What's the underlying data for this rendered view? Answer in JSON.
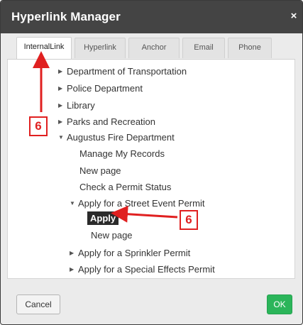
{
  "dialog": {
    "title": "Hyperlink Manager",
    "close_label": "×"
  },
  "tabs": [
    {
      "label": "InternalLink",
      "active": true
    },
    {
      "label": "Hyperlink",
      "active": false
    },
    {
      "label": "Anchor",
      "active": false
    },
    {
      "label": "Email",
      "active": false
    },
    {
      "label": "Phone",
      "active": false
    }
  ],
  "tree": [
    {
      "label": "Department of Transportation",
      "arrow": "right"
    },
    {
      "label": "Police Department",
      "arrow": "right"
    },
    {
      "label": "Library",
      "arrow": "right"
    },
    {
      "label": "Parks and Recreation",
      "arrow": "right"
    },
    {
      "label": "Augustus Fire Department",
      "arrow": "down"
    },
    {
      "label": "Manage My Records",
      "arrow": "none"
    },
    {
      "label": "New page",
      "arrow": "none"
    },
    {
      "label": "Check a Permit Status",
      "arrow": "none"
    },
    {
      "label": "Apply for a Street Event Permit",
      "arrow": "down"
    },
    {
      "label": "Apply",
      "arrow": "none",
      "selected": true
    },
    {
      "label": "New page",
      "arrow": "none"
    },
    {
      "label": "Apply for a Sprinkler Permit",
      "arrow": "right"
    },
    {
      "label": "Apply for a Special Effects Permit",
      "arrow": "right"
    }
  ],
  "footer": {
    "cancel_label": "Cancel",
    "ok_label": "OK"
  },
  "annotations": {
    "step_number_left": "6",
    "step_number_right": "6",
    "color": "#e02020"
  },
  "colors": {
    "titlebar": "#444444",
    "ok_button": "#2bb55a",
    "selected_bg": "#2b2b2b"
  }
}
